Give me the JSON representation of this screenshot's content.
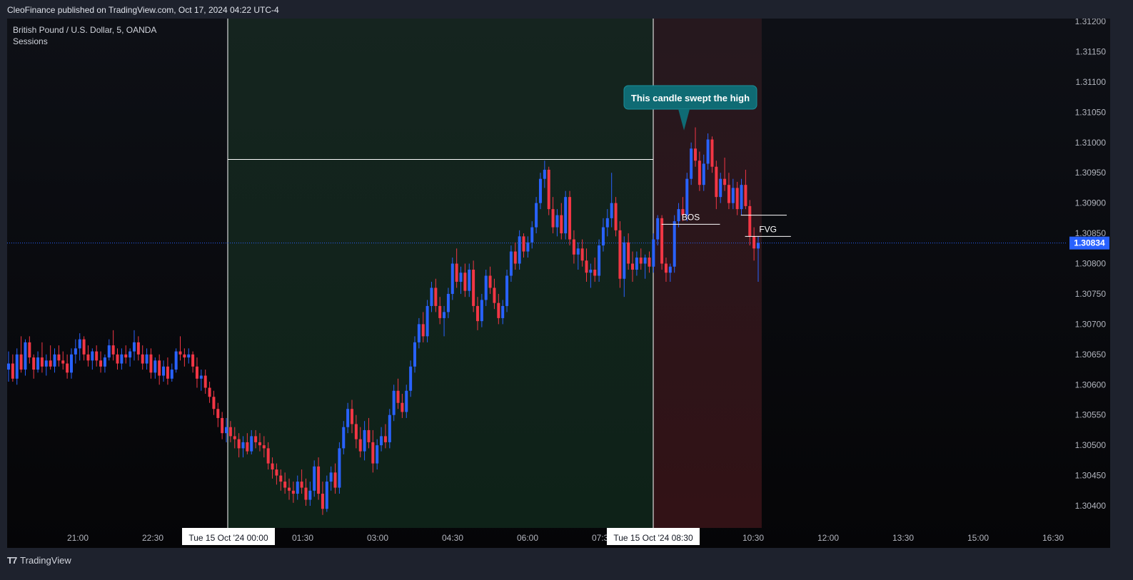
{
  "header": {
    "published": "CleoFinance published on TradingView.com, Oct 17, 2024 04:22 UTC-4"
  },
  "legend": {
    "symbol": "British Pound / U.S. Dollar, 5, OANDA",
    "indicator": "Sessions"
  },
  "footer": {
    "brand": "TradingView",
    "brand_icon": "tradingview-logo-icon"
  },
  "colors": {
    "up": "#2962ff",
    "down": "#f23645",
    "asia_session": "#0e2218",
    "london_session": "#3a1418",
    "callout": "#0f6b74",
    "price_badge": "#2962ff"
  },
  "chart_data": {
    "type": "candlestick",
    "title": "",
    "symbol": "British Pound / U.S. Dollar, 5, OANDA",
    "ylim": [
      1.3038,
      1.312
    ],
    "y_ticks": [
      "1.31200",
      "1.31150",
      "1.31100",
      "1.31050",
      "1.31000",
      "1.30950",
      "1.30900",
      "1.30850",
      "1.30800",
      "1.30750",
      "1.30700",
      "1.30650",
      "1.30600",
      "1.30550",
      "1.30500",
      "1.30450",
      "1.30400"
    ],
    "x_ticks": [
      "21:00",
      "22:30",
      "Tue 15 Oct '24  00:00",
      "01:30",
      "03:00",
      "04:30",
      "06:00",
      "07:30",
      "Tue 15 Oct '24  08:30",
      "10:30",
      "12:00",
      "13:30",
      "15:00",
      "16:30"
    ],
    "highlighted_x_ticks": [
      "Tue 15 Oct '24  00:00",
      "Tue 15 Oct '24  08:30"
    ],
    "last_price": "1.30834",
    "sessions": [
      {
        "start": "00:00",
        "end": "08:30",
        "high": 1.30972
      },
      {
        "start": "08:30",
        "end": "10:40"
      }
    ],
    "annotations": [
      {
        "text": "This candle swept the high",
        "x": "09:00",
        "price": 1.3102
      },
      {
        "text": "BOS",
        "price": 1.30865,
        "from": "08:40",
        "to": "09:50"
      },
      {
        "text": "FVG",
        "price": 1.30845,
        "from": "10:20",
        "to": "11:15"
      },
      {
        "text": "",
        "price": 1.3088,
        "from": "10:15",
        "to": "11:10"
      }
    ],
    "candles": [
      [
        1.30625,
        1.30655,
        1.30605,
        1.30635
      ],
      [
        1.30635,
        1.3065,
        1.30605,
        1.3061
      ],
      [
        1.3061,
        1.3066,
        1.306,
        1.3065
      ],
      [
        1.3065,
        1.3068,
        1.3062,
        1.30625
      ],
      [
        1.30625,
        1.30675,
        1.30615,
        1.3067
      ],
      [
        1.3067,
        1.3068,
        1.30635,
        1.30645
      ],
      [
        1.30645,
        1.3065,
        1.3061,
        1.30625
      ],
      [
        1.30625,
        1.30655,
        1.3062,
        1.30645
      ],
      [
        1.30645,
        1.3067,
        1.3062,
        1.3063
      ],
      [
        1.3063,
        1.3065,
        1.30615,
        1.3064
      ],
      [
        1.3064,
        1.30665,
        1.30625,
        1.3063
      ],
      [
        1.3063,
        1.3066,
        1.3062,
        1.3065
      ],
      [
        1.3065,
        1.30665,
        1.3063,
        1.3064
      ],
      [
        1.3064,
        1.30655,
        1.30625,
        1.30635
      ],
      [
        1.30635,
        1.3065,
        1.3061,
        1.3062
      ],
      [
        1.3062,
        1.3066,
        1.3061,
        1.3065
      ],
      [
        1.3065,
        1.30675,
        1.30635,
        1.3066
      ],
      [
        1.3066,
        1.30685,
        1.3064,
        1.30675
      ],
      [
        1.30675,
        1.3068,
        1.3064,
        1.3065
      ],
      [
        1.3065,
        1.30665,
        1.3063,
        1.3064
      ],
      [
        1.3064,
        1.3066,
        1.30625,
        1.30655
      ],
      [
        1.30655,
        1.30665,
        1.3063,
        1.3064
      ],
      [
        1.3064,
        1.30655,
        1.3062,
        1.3063
      ],
      [
        1.3063,
        1.3065,
        1.3062,
        1.30645
      ],
      [
        1.30645,
        1.30675,
        1.3064,
        1.30665
      ],
      [
        1.30665,
        1.3069,
        1.3064,
        1.3065
      ],
      [
        1.3065,
        1.3066,
        1.30625,
        1.30635
      ],
      [
        1.30635,
        1.3066,
        1.30625,
        1.3065
      ],
      [
        1.3065,
        1.30665,
        1.30635,
        1.30645
      ],
      [
        1.30645,
        1.3066,
        1.3063,
        1.30655
      ],
      [
        1.30655,
        1.3069,
        1.3064,
        1.3067
      ],
      [
        1.3067,
        1.3068,
        1.3064,
        1.3065
      ],
      [
        1.3065,
        1.30665,
        1.30625,
        1.30635
      ],
      [
        1.30635,
        1.3066,
        1.30625,
        1.3065
      ],
      [
        1.3065,
        1.3066,
        1.3061,
        1.3062
      ],
      [
        1.3062,
        1.30645,
        1.3061,
        1.3064
      ],
      [
        1.3064,
        1.3065,
        1.306,
        1.30615
      ],
      [
        1.30615,
        1.3064,
        1.30605,
        1.3063
      ],
      [
        1.3063,
        1.30645,
        1.306,
        1.3061
      ],
      [
        1.3061,
        1.30635,
        1.30605,
        1.30625
      ],
      [
        1.30625,
        1.3066,
        1.3062,
        1.30655
      ],
      [
        1.30655,
        1.3068,
        1.3064,
        1.3065
      ],
      [
        1.3065,
        1.3066,
        1.3063,
        1.30645
      ],
      [
        1.30645,
        1.3066,
        1.30635,
        1.3065
      ],
      [
        1.3065,
        1.30655,
        1.3062,
        1.3063
      ],
      [
        1.3063,
        1.30645,
        1.30595,
        1.3061
      ],
      [
        1.3061,
        1.30625,
        1.3059,
        1.30615
      ],
      [
        1.30615,
        1.30625,
        1.30585,
        1.30595
      ],
      [
        1.30595,
        1.30605,
        1.3057,
        1.3058
      ],
      [
        1.3058,
        1.3059,
        1.3055,
        1.3056
      ],
      [
        1.3056,
        1.3057,
        1.3053,
        1.30545
      ],
      [
        1.30545,
        1.30555,
        1.3051,
        1.3052
      ],
      [
        1.3052,
        1.30545,
        1.30505,
        1.3053
      ],
      [
        1.3053,
        1.3054,
        1.30505,
        1.30515
      ],
      [
        1.30515,
        1.3053,
        1.30495,
        1.3051
      ],
      [
        1.3051,
        1.3052,
        1.3048,
        1.30495
      ],
      [
        1.30495,
        1.30515,
        1.3048,
        1.30505
      ],
      [
        1.30505,
        1.3052,
        1.30485,
        1.3049
      ],
      [
        1.3049,
        1.30525,
        1.30485,
        1.30515
      ],
      [
        1.30515,
        1.30525,
        1.30495,
        1.30505
      ],
      [
        1.30505,
        1.3052,
        1.3049,
        1.305
      ],
      [
        1.305,
        1.30515,
        1.3048,
        1.30495
      ],
      [
        1.30495,
        1.30505,
        1.3046,
        1.3047
      ],
      [
        1.3047,
        1.3048,
        1.30445,
        1.3046
      ],
      [
        1.3046,
        1.3047,
        1.30435,
        1.3045
      ],
      [
        1.3045,
        1.3046,
        1.30425,
        1.3044
      ],
      [
        1.3044,
        1.30455,
        1.3042,
        1.3043
      ],
      [
        1.3043,
        1.30445,
        1.3041,
        1.30425
      ],
      [
        1.30425,
        1.3044,
        1.30405,
        1.3042
      ],
      [
        1.3042,
        1.3045,
        1.3041,
        1.3044
      ],
      [
        1.3044,
        1.3046,
        1.3042,
        1.3043
      ],
      [
        1.3043,
        1.30445,
        1.304,
        1.3041
      ],
      [
        1.3041,
        1.3044,
        1.304,
        1.30425
      ],
      [
        1.30425,
        1.30475,
        1.30415,
        1.30465
      ],
      [
        1.30465,
        1.3048,
        1.3041,
        1.3042
      ],
      [
        1.3042,
        1.3044,
        1.30385,
        1.30395
      ],
      [
        1.30395,
        1.3045,
        1.3039,
        1.3044
      ],
      [
        1.3044,
        1.30465,
        1.30425,
        1.30455
      ],
      [
        1.30455,
        1.3047,
        1.3042,
        1.3043
      ],
      [
        1.3043,
        1.30505,
        1.3042,
        1.30495
      ],
      [
        1.30495,
        1.3054,
        1.30485,
        1.3053
      ],
      [
        1.3053,
        1.3057,
        1.3052,
        1.3056
      ],
      [
        1.3056,
        1.30575,
        1.3052,
        1.30535
      ],
      [
        1.30535,
        1.3055,
        1.30495,
        1.3051
      ],
      [
        1.3051,
        1.3053,
        1.3048,
        1.3049
      ],
      [
        1.3049,
        1.3054,
        1.30475,
        1.30525
      ],
      [
        1.30525,
        1.30545,
        1.30495,
        1.30505
      ],
      [
        1.30505,
        1.30525,
        1.30455,
        1.3047
      ],
      [
        1.3047,
        1.3051,
        1.3046,
        1.305
      ],
      [
        1.305,
        1.3053,
        1.3049,
        1.30515
      ],
      [
        1.30515,
        1.30535,
        1.30495,
        1.30505
      ],
      [
        1.30505,
        1.3056,
        1.30495,
        1.3055
      ],
      [
        1.3055,
        1.306,
        1.3054,
        1.3059
      ],
      [
        1.3059,
        1.3061,
        1.3056,
        1.3057
      ],
      [
        1.3057,
        1.30585,
        1.30545,
        1.30555
      ],
      [
        1.30555,
        1.306,
        1.30545,
        1.3059
      ],
      [
        1.3059,
        1.3064,
        1.3058,
        1.3063
      ],
      [
        1.3063,
        1.3068,
        1.3062,
        1.3067
      ],
      [
        1.3067,
        1.3071,
        1.3066,
        1.307
      ],
      [
        1.307,
        1.3072,
        1.3067,
        1.3068
      ],
      [
        1.3068,
        1.3074,
        1.3067,
        1.3073
      ],
      [
        1.3073,
        1.3077,
        1.3072,
        1.3076
      ],
      [
        1.3076,
        1.30775,
        1.3072,
        1.3073
      ],
      [
        1.3073,
        1.30745,
        1.307,
        1.3071
      ],
      [
        1.3071,
        1.3073,
        1.3068,
        1.3072
      ],
      [
        1.3072,
        1.3076,
        1.3071,
        1.3075
      ],
      [
        1.3075,
        1.3081,
        1.3074,
        1.308
      ],
      [
        1.308,
        1.30825,
        1.3076,
        1.3077
      ],
      [
        1.3077,
        1.30795,
        1.3075,
        1.30785
      ],
      [
        1.30785,
        1.308,
        1.30745,
        1.30755
      ],
      [
        1.30755,
        1.308,
        1.30745,
        1.3079
      ],
      [
        1.3079,
        1.30805,
        1.3072,
        1.3073
      ],
      [
        1.3073,
        1.30745,
        1.3069,
        1.30705
      ],
      [
        1.30705,
        1.3075,
        1.30695,
        1.3074
      ],
      [
        1.3074,
        1.3079,
        1.3073,
        1.3078
      ],
      [
        1.3078,
        1.30795,
        1.3075,
        1.3076
      ],
      [
        1.3076,
        1.30775,
        1.30725,
        1.30735
      ],
      [
        1.30735,
        1.3075,
        1.307,
        1.3071
      ],
      [
        1.3071,
        1.3074,
        1.307,
        1.3073
      ],
      [
        1.3073,
        1.3079,
        1.3072,
        1.3078
      ],
      [
        1.3078,
        1.3083,
        1.3077,
        1.3082
      ],
      [
        1.3082,
        1.30835,
        1.3079,
        1.308
      ],
      [
        1.308,
        1.30855,
        1.3079,
        1.30845
      ],
      [
        1.30845,
        1.3085,
        1.3081,
        1.3082
      ],
      [
        1.3082,
        1.30845,
        1.3081,
        1.30835
      ],
      [
        1.30835,
        1.3087,
        1.30825,
        1.3086
      ],
      [
        1.3086,
        1.3091,
        1.3085,
        1.309
      ],
      [
        1.309,
        1.3095,
        1.3089,
        1.3094
      ],
      [
        1.3094,
        1.3097,
        1.30925,
        1.30955
      ],
      [
        1.30955,
        1.3096,
        1.3088,
        1.3089
      ],
      [
        1.3089,
        1.3091,
        1.3085,
        1.3086
      ],
      [
        1.3086,
        1.3089,
        1.30845,
        1.3088
      ],
      [
        1.3088,
        1.309,
        1.3084,
        1.3085
      ],
      [
        1.3085,
        1.3092,
        1.3084,
        1.3091
      ],
      [
        1.3091,
        1.3092,
        1.3083,
        1.3084
      ],
      [
        1.3084,
        1.30855,
        1.308,
        1.30815
      ],
      [
        1.30815,
        1.30835,
        1.3079,
        1.30825
      ],
      [
        1.30825,
        1.3084,
        1.30795,
        1.30805
      ],
      [
        1.30805,
        1.30825,
        1.3077,
        1.30785
      ],
      [
        1.30785,
        1.308,
        1.3076,
        1.3079
      ],
      [
        1.3079,
        1.3081,
        1.3077,
        1.3078
      ],
      [
        1.3078,
        1.3084,
        1.3077,
        1.3083
      ],
      [
        1.3083,
        1.30875,
        1.3082,
        1.3086
      ],
      [
        1.3086,
        1.3089,
        1.30845,
        1.30875
      ],
      [
        1.30875,
        1.3095,
        1.3086,
        1.309
      ],
      [
        1.309,
        1.3091,
        1.30845,
        1.30855
      ],
      [
        1.30855,
        1.3087,
        1.3076,
        1.30775
      ],
      [
        1.30775,
        1.30845,
        1.30745,
        1.30835
      ],
      [
        1.30835,
        1.3085,
        1.3079,
        1.308
      ],
      [
        1.308,
        1.3082,
        1.3077,
        1.3079
      ],
      [
        1.3079,
        1.3082,
        1.3078,
        1.3081
      ],
      [
        1.3081,
        1.30825,
        1.3079,
        1.308
      ],
      [
        1.308,
        1.30815,
        1.30775,
        1.3081
      ],
      [
        1.3081,
        1.3082,
        1.30785,
        1.30795
      ],
      [
        1.30795,
        1.3085,
        1.30785,
        1.3084
      ],
      [
        1.3084,
        1.3088,
        1.3083,
        1.30875
      ],
      [
        1.30875,
        1.3088,
        1.3079,
        1.308
      ],
      [
        1.308,
        1.3081,
        1.3077,
        1.30785
      ],
      [
        1.30785,
        1.308,
        1.3077,
        1.30795
      ],
      [
        1.30795,
        1.3088,
        1.30785,
        1.3087
      ],
      [
        1.3087,
        1.309,
        1.3086,
        1.3089
      ],
      [
        1.3089,
        1.3091,
        1.3087,
        1.3088
      ],
      [
        1.3088,
        1.3095,
        1.3087,
        1.3094
      ],
      [
        1.3094,
        1.31,
        1.3093,
        1.3099
      ],
      [
        1.3099,
        1.31025,
        1.3096,
        1.3097
      ],
      [
        1.3097,
        1.30985,
        1.3092,
        1.3093
      ],
      [
        1.3093,
        1.3098,
        1.3092,
        1.30965
      ],
      [
        1.30965,
        1.31015,
        1.30955,
        1.31005
      ],
      [
        1.31005,
        1.3101,
        1.3095,
        1.3096
      ],
      [
        1.3096,
        1.3097,
        1.3089,
        1.3091
      ],
      [
        1.3091,
        1.3095,
        1.309,
        1.3094
      ],
      [
        1.3094,
        1.30975,
        1.3092,
        1.3093
      ],
      [
        1.3093,
        1.3095,
        1.3089,
        1.309
      ],
      [
        1.309,
        1.3094,
        1.3089,
        1.30925
      ],
      [
        1.30925,
        1.30935,
        1.3088,
        1.3089
      ],
      [
        1.3089,
        1.3094,
        1.3088,
        1.3093
      ],
      [
        1.3093,
        1.30955,
        1.3089,
        1.30895
      ],
      [
        1.30895,
        1.30905,
        1.3083,
        1.30845
      ],
      [
        1.30845,
        1.3086,
        1.30805,
        1.30825
      ],
      [
        1.30825,
        1.30845,
        1.3077,
        1.30834
      ]
    ]
  }
}
